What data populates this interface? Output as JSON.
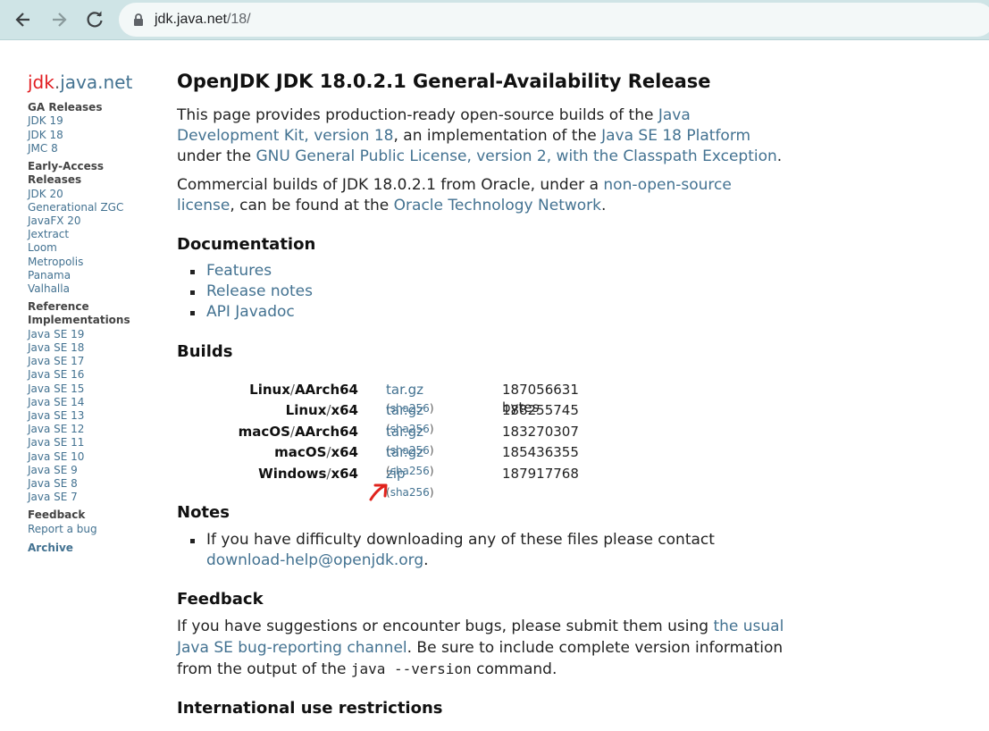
{
  "browser": {
    "url_host": "jdk.java.net",
    "url_path": "/18/"
  },
  "sidebar": {
    "logo_a": "jdk",
    "logo_b": ".",
    "logo_c": "java.net",
    "groups": [
      {
        "heading": "GA Releases",
        "items": [
          "JDK 19",
          "JDK 18",
          "JMC 8"
        ]
      },
      {
        "heading": "Early-Access Releases",
        "items": [
          "JDK 20",
          "Generational ZGC",
          "JavaFX 20",
          "Jextract",
          "Loom",
          "Metropolis",
          "Panama",
          "Valhalla"
        ]
      },
      {
        "heading": "Reference Implementations",
        "items": [
          "Java SE 19",
          "Java SE 18",
          "Java SE 17",
          "Java SE 16",
          "Java SE 15",
          "Java SE 14",
          "Java SE 13",
          "Java SE 12",
          "Java SE 11",
          "Java SE 10",
          "Java SE 9",
          "Java SE 8",
          "Java SE 7"
        ]
      },
      {
        "heading": "Feedback",
        "items": [
          "Report a bug"
        ]
      }
    ],
    "archive": "Archive"
  },
  "main": {
    "title": "OpenJDK JDK 18.0.2.1 General-Availability Release",
    "intro": {
      "t1": "This page provides production-ready open-source builds of the ",
      "l1": "Java Development Kit, version 18",
      "t2": ", an implementation of the ",
      "l2": "Java SE 18 Platform",
      "t3": " under the ",
      "l3": "GNU General Public License, version 2, with the Classpath Exception",
      "t4": "."
    },
    "commercial": {
      "t1": "Commercial builds of JDK 18.0.2.1 from Oracle, under a ",
      "l1": "non-open-source license",
      "t2": ", can be found at the ",
      "l2": "Oracle Technology Network",
      "t3": "."
    },
    "documentation": {
      "heading": "Documentation",
      "items": [
        "Features",
        "Release notes",
        "API Javadoc"
      ]
    },
    "builds": {
      "heading": "Builds",
      "sep": "/",
      "rows": [
        {
          "os": "Linux",
          "arch": "AArch64",
          "pkg": "tar.gz",
          "sha_open": "(",
          "sha": "sha256",
          "sha_close": ")",
          "size": "187056631 bytes"
        },
        {
          "os": "Linux",
          "arch": "x64",
          "pkg": "tar.gz",
          "sha_open": "(",
          "sha": "sha256",
          "sha_close": ")",
          "size": "188255745"
        },
        {
          "os": "macOS",
          "arch": "AArch64",
          "pkg": "tar.gz",
          "sha_open": "(",
          "sha": "sha256",
          "sha_close": ")",
          "size": "183270307"
        },
        {
          "os": "macOS",
          "arch": "x64",
          "pkg": "tar.gz",
          "sha_open": "(",
          "sha": "sha256",
          "sha_close": ")",
          "size": "185436355"
        },
        {
          "os": "Windows",
          "arch": "x64",
          "pkg": "zip",
          "sha_open": "(",
          "sha": "sha256",
          "sha_close": ")",
          "size": "187917768"
        }
      ]
    },
    "notes": {
      "heading": "Notes",
      "t1": "If you have difficulty downloading any of these files please contact ",
      "l1": "download-help@openjdk.org",
      "t2": "."
    },
    "feedback": {
      "heading": "Feedback",
      "t1": "If you have suggestions or encounter bugs, please submit them using ",
      "l1": "the usual Java SE bug-reporting channel",
      "t2": ". Be sure to include complete version information from the output of the ",
      "code": "java --version",
      "t3": " command."
    },
    "intl_heading": "International use restrictions"
  },
  "colors": {
    "link": "#437291",
    "logo_red": "#e11d21",
    "annotation": "#e0231c",
    "browser_bar": "#cfe4e6"
  }
}
